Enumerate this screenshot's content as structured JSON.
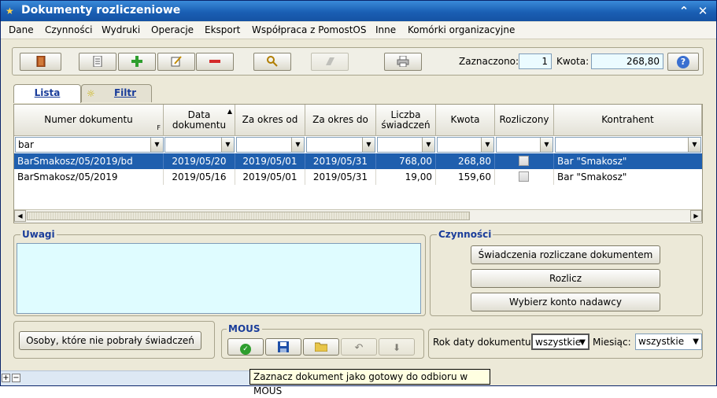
{
  "window": {
    "title": "Dokumenty rozliczeniowe"
  },
  "menu": [
    "Dane",
    "Czynności",
    "Wydruki",
    "Operacje",
    "Eksport",
    "Współpraca z PomostOS",
    "Inne",
    "Komórki organizacyjne"
  ],
  "toolbar": {
    "zaznaczono_label": "Zaznaczono:",
    "zaznaczono_value": "1",
    "kwota_label": "Kwota:",
    "kwota_value": "268,80",
    "help_label": "?"
  },
  "tabs": [
    {
      "label": "Lista"
    },
    {
      "label": "Filtr"
    }
  ],
  "grid": {
    "columns": [
      "Numer dokumentu",
      "Data dokumentu",
      "Za okres od",
      "Za okres do",
      "Liczba świadczeń",
      "Kwota",
      "Rozliczony",
      "Kontrahent"
    ],
    "filter_value": "bar",
    "rows": [
      {
        "numer": "BarSmakosz/05/2019/bd",
        "data": "2019/05/20",
        "od": "2019/05/01",
        "do": "2019/05/31",
        "liczba": "768,00",
        "kwota": "268,80",
        "kontrahent": "Bar \"Smakosz\""
      },
      {
        "numer": "BarSmakosz/05/2019",
        "data": "2019/05/16",
        "od": "2019/05/01",
        "do": "2019/05/31",
        "liczba": "19,00",
        "kwota": "159,60",
        "kontrahent": "Bar \"Smakosz\""
      }
    ]
  },
  "uwagi": {
    "title": "Uwagi"
  },
  "czynnosci": {
    "title": "Czynności",
    "buttons": [
      "Świadczenia rozliczane dokumentem",
      "Rozlicz",
      "Wybierz konto nadawcy"
    ]
  },
  "osoby_button": "Osoby, które nie pobrały świadczeń",
  "mous": {
    "title": "MOUS"
  },
  "filters": {
    "rok_label": "Rok daty dokumentu:",
    "rok_value": "wszystkie",
    "miesiac_label": "Miesiąc:",
    "miesiac_value": "wszystkie"
  },
  "tooltip": "Zaznacz dokument jako gotowy do odbioru w MOUS",
  "colors": {
    "title_bar": "#1a5fb4",
    "selection": "#1f5fae",
    "group_title": "#1a3d9a",
    "uwagi_bg": "#dffcff"
  }
}
